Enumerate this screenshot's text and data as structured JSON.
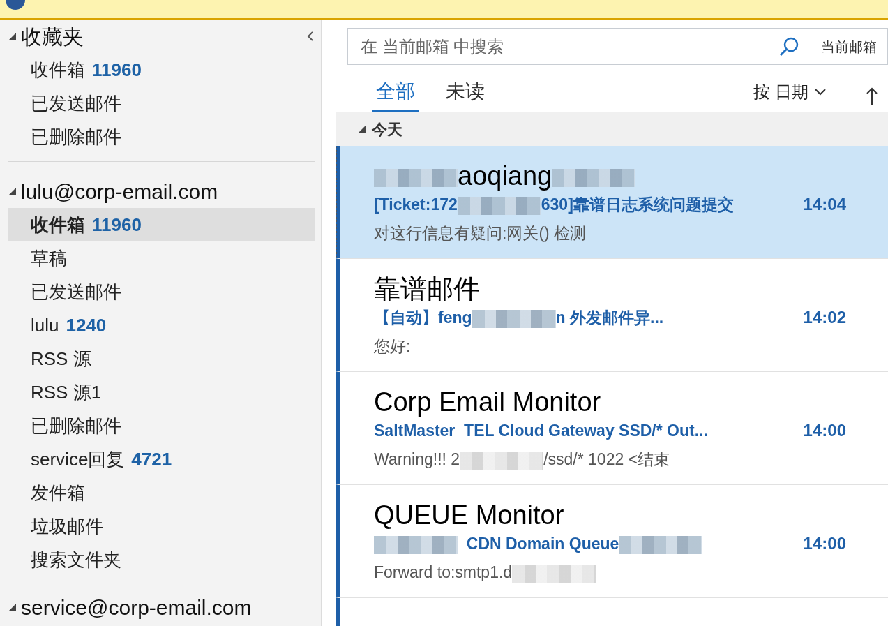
{
  "banner": {
    "kind": "info"
  },
  "favorites": {
    "title": "收藏夹",
    "expanded": true,
    "items": [
      {
        "label": "收件箱",
        "count": "11960",
        "selected": false
      },
      {
        "label": "已发送邮件",
        "selected": false
      },
      {
        "label": "已删除邮件",
        "selected": false
      }
    ]
  },
  "accounts": [
    {
      "title": "lulu@corp-email.com",
      "expanded": true,
      "items": [
        {
          "label": "收件箱",
          "count": "11960",
          "selected": true
        },
        {
          "label": "草稿",
          "selected": false
        },
        {
          "label": "已发送邮件",
          "selected": false
        },
        {
          "label": "lulu",
          "count": "1240",
          "selected": false
        },
        {
          "label": "RSS 源",
          "selected": false
        },
        {
          "label": "RSS 源1",
          "selected": false
        },
        {
          "label": "已删除邮件",
          "selected": false
        },
        {
          "label": "service回复",
          "count": "4721",
          "selected": false
        },
        {
          "label": "发件箱",
          "selected": false
        },
        {
          "label": "垃圾邮件",
          "selected": false
        },
        {
          "label": "搜索文件夹",
          "selected": false
        }
      ]
    },
    {
      "title": "service@corp-email.com",
      "expanded": true
    }
  ],
  "search": {
    "placeholder": "在 当前邮箱 中搜索",
    "scope": "当前邮箱"
  },
  "tabs": [
    {
      "label": "全部",
      "selected": true
    },
    {
      "label": "未读",
      "selected": false
    }
  ],
  "sort": {
    "label": "按 日期"
  },
  "group": {
    "title": "今天",
    "expanded": true
  },
  "messages": [
    {
      "selected": true,
      "unread": true,
      "sender": [
        {
          "kind": "blur"
        },
        {
          "kind": "text",
          "text": "aoqiang"
        },
        {
          "kind": "blur"
        }
      ],
      "subject": [
        {
          "kind": "text",
          "text": "[Ticket:172"
        },
        {
          "kind": "blur"
        },
        {
          "kind": "text",
          "text": "630]靠谱日志系统问题提交"
        }
      ],
      "time": "14:04",
      "preview": [
        {
          "kind": "text",
          "text": "对这行信息有疑问:网关() 检测"
        }
      ]
    },
    {
      "selected": false,
      "unread": true,
      "sender": [
        {
          "kind": "text",
          "text": "靠谱邮件"
        }
      ],
      "subject": [
        {
          "kind": "text",
          "text": "【自动】feng"
        },
        {
          "kind": "blur"
        },
        {
          "kind": "text",
          "text": "n 外发邮件异..."
        }
      ],
      "time": "14:02",
      "preview": [
        {
          "kind": "text",
          "text": "您好:"
        }
      ]
    },
    {
      "selected": false,
      "unread": true,
      "sender": [
        {
          "kind": "text",
          "text": "Corp Email Monitor"
        }
      ],
      "subject": [
        {
          "kind": "text",
          "text": "SaltMaster_TEL Cloud Gateway SSD/* Out..."
        }
      ],
      "time": "14:00",
      "preview": [
        {
          "kind": "text",
          "text": "Warning!!! 2"
        },
        {
          "kind": "blur"
        },
        {
          "kind": "text",
          "text": "/ssd/* 1022 <结束"
        }
      ]
    },
    {
      "selected": false,
      "unread": true,
      "sender": [
        {
          "kind": "text",
          "text": "QUEUE Monitor"
        }
      ],
      "subject": [
        {
          "kind": "blur"
        },
        {
          "kind": "text",
          "text": "_CDN Domain Queue"
        },
        {
          "kind": "blur"
        }
      ],
      "time": "14:00",
      "preview": [
        {
          "kind": "text",
          "text": "Forward to:smtp1.d"
        },
        {
          "kind": "blur"
        }
      ]
    },
    {
      "selected": false,
      "unread": true
    }
  ]
}
